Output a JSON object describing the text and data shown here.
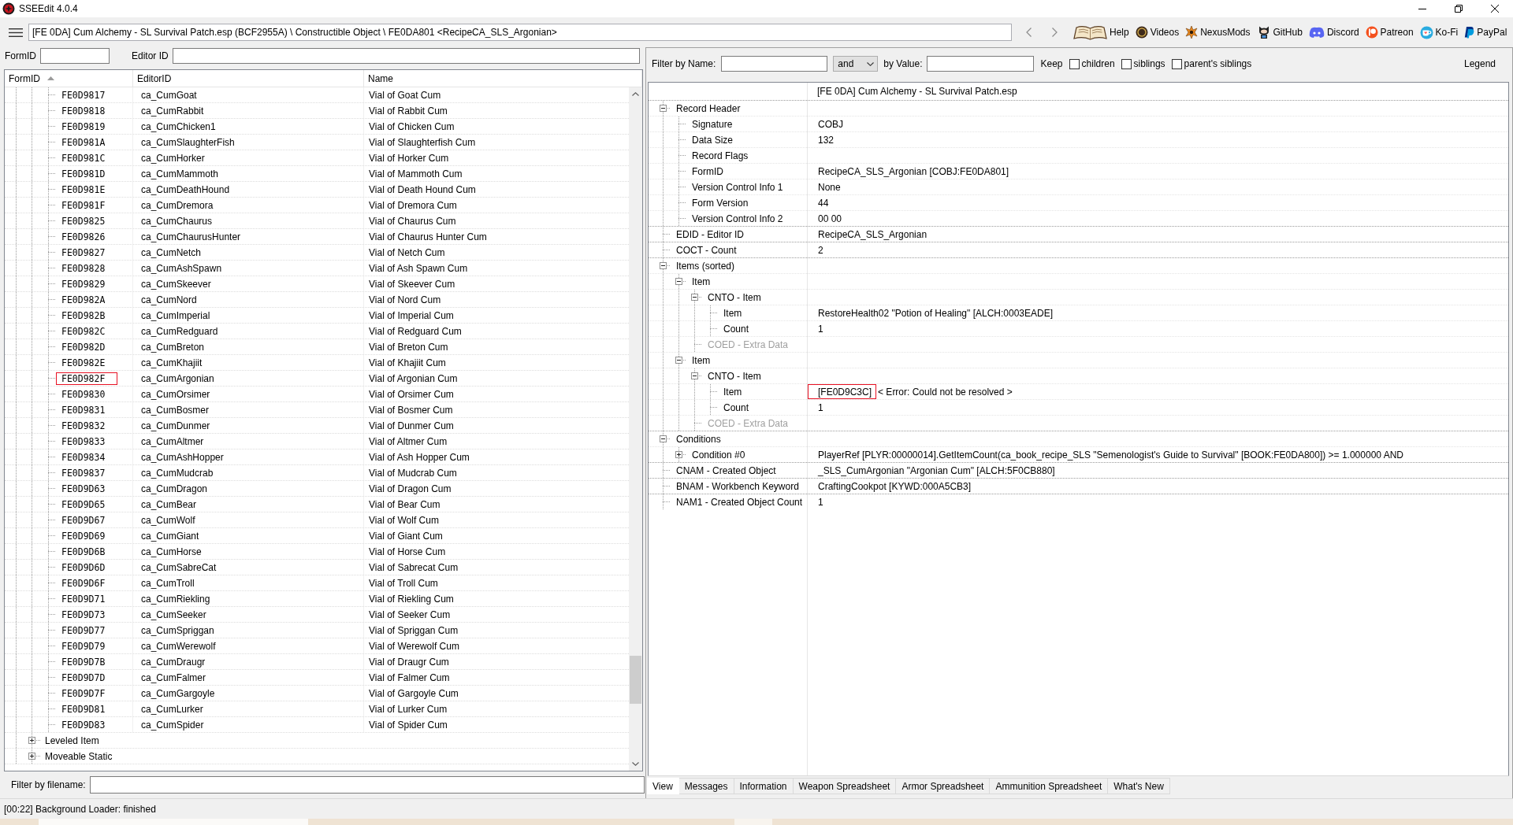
{
  "window": {
    "title": "SSEEdit 4.0.4"
  },
  "toolbar": {
    "path": "[FE 0DA] Cum Alchemy - SL Survival Patch.esp (BCF2955A) \\ Constructible Object \\ FE0DA801 <RecipeCA_SLS_Argonian>",
    "links": [
      {
        "kind": "book",
        "label": "Help"
      },
      {
        "kind": "gp",
        "label": "Videos"
      },
      {
        "kind": "nexus",
        "label": "NexusMods"
      },
      {
        "kind": "github",
        "label": "GitHub"
      },
      {
        "kind": "discord",
        "label": "Discord"
      },
      {
        "kind": "patreon",
        "label": "Patreon"
      },
      {
        "kind": "kofi",
        "label": "Ko-Fi"
      },
      {
        "kind": "paypal",
        "label": "PayPal"
      }
    ]
  },
  "left_pane": {
    "form_id_label": "FormID",
    "editor_id_label": "Editor ID",
    "list": {
      "columns": [
        {
          "label": "FormID",
          "sorted": true
        },
        {
          "label": "EditorID",
          "sorted": false
        },
        {
          "label": "Name",
          "sorted": false
        }
      ],
      "rows": [
        {
          "form_id": "FE0D9817",
          "editor_id": "ca_CumGoat",
          "name": "Vial of Goat Cum",
          "selected": false
        },
        {
          "form_id": "FE0D9818",
          "editor_id": "ca_CumRabbit",
          "name": "Vial of Rabbit Cum",
          "selected": false
        },
        {
          "form_id": "FE0D9819",
          "editor_id": "ca_CumChicken1",
          "name": "Vial of Chicken Cum",
          "selected": false
        },
        {
          "form_id": "FE0D981A",
          "editor_id": "ca_CumSlaughterFish",
          "name": "Vial of Slaughterfish Cum",
          "selected": false
        },
        {
          "form_id": "FE0D981C",
          "editor_id": "ca_CumHorker",
          "name": "Vial of Horker Cum",
          "selected": false
        },
        {
          "form_id": "FE0D981D",
          "editor_id": "ca_CumMammoth",
          "name": "Vial of Mammoth Cum",
          "selected": false
        },
        {
          "form_id": "FE0D981E",
          "editor_id": "ca_CumDeathHound",
          "name": "Vial of Death Hound Cum",
          "selected": false
        },
        {
          "form_id": "FE0D981F",
          "editor_id": "ca_CumDremora",
          "name": "Vial of Dremora Cum",
          "selected": false
        },
        {
          "form_id": "FE0D9825",
          "editor_id": "ca_CumChaurus",
          "name": "Vial of Chaurus Cum",
          "selected": false
        },
        {
          "form_id": "FE0D9826",
          "editor_id": "ca_CumChaurusHunter",
          "name": "Vial of Chaurus Hunter Cum",
          "selected": false
        },
        {
          "form_id": "FE0D9827",
          "editor_id": "ca_CumNetch",
          "name": "Vial of Netch Cum",
          "selected": false
        },
        {
          "form_id": "FE0D9828",
          "editor_id": "ca_CumAshSpawn",
          "name": "Vial of Ash Spawn Cum",
          "selected": false
        },
        {
          "form_id": "FE0D9829",
          "editor_id": "ca_CumSkeever",
          "name": "Vial of Skeever Cum",
          "selected": false
        },
        {
          "form_id": "FE0D982A",
          "editor_id": "ca_CumNord",
          "name": "Vial of Nord Cum",
          "selected": false
        },
        {
          "form_id": "FE0D982B",
          "editor_id": "ca_CumImperial",
          "name": "Vial of Imperial Cum",
          "selected": false
        },
        {
          "form_id": "FE0D982C",
          "editor_id": "ca_CumRedguard",
          "name": "Vial of Redguard Cum",
          "selected": false
        },
        {
          "form_id": "FE0D982D",
          "editor_id": "ca_CumBreton",
          "name": "Vial of Breton Cum",
          "selected": false
        },
        {
          "form_id": "FE0D982E",
          "editor_id": "ca_CumKhajiit",
          "name": "Vial of Khajiit Cum",
          "selected": false
        },
        {
          "form_id": "FE0D982F",
          "editor_id": "ca_CumArgonian",
          "name": "Vial of Argonian Cum",
          "selected": true
        },
        {
          "form_id": "FE0D9830",
          "editor_id": "ca_CumOrsimer",
          "name": "Vial of Orsimer Cum",
          "selected": false
        },
        {
          "form_id": "FE0D9831",
          "editor_id": "ca_CumBosmer",
          "name": "Vial of Bosmer Cum",
          "selected": false
        },
        {
          "form_id": "FE0D9832",
          "editor_id": "ca_CumDunmer",
          "name": "Vial of Dunmer Cum",
          "selected": false
        },
        {
          "form_id": "FE0D9833",
          "editor_id": "ca_CumAltmer",
          "name": "Vial of Altmer Cum",
          "selected": false
        },
        {
          "form_id": "FE0D9834",
          "editor_id": "ca_CumAshHopper",
          "name": "Vial of Ash Hopper Cum",
          "selected": false
        },
        {
          "form_id": "FE0D9837",
          "editor_id": "ca_CumMudcrab",
          "name": "Vial of Mudcrab Cum",
          "selected": false
        },
        {
          "form_id": "FE0D9D63",
          "editor_id": "ca_CumDragon",
          "name": "Vial of Dragon Cum",
          "selected": false
        },
        {
          "form_id": "FE0D9D65",
          "editor_id": "ca_CumBear",
          "name": "Vial of Bear Cum",
          "selected": false
        },
        {
          "form_id": "FE0D9D67",
          "editor_id": "ca_CumWolf",
          "name": "Vial of Wolf Cum",
          "selected": false
        },
        {
          "form_id": "FE0D9D69",
          "editor_id": "ca_CumGiant",
          "name": "Vial of Giant Cum",
          "selected": false
        },
        {
          "form_id": "FE0D9D6B",
          "editor_id": "ca_CumHorse",
          "name": "Vial of Horse Cum",
          "selected": false
        },
        {
          "form_id": "FE0D9D6D",
          "editor_id": "ca_CumSabreCat",
          "name": "Vial of Sabrecat Cum",
          "selected": false
        },
        {
          "form_id": "FE0D9D6F",
          "editor_id": "ca_CumTroll",
          "name": "Vial of Troll Cum",
          "selected": false
        },
        {
          "form_id": "FE0D9D71",
          "editor_id": "ca_CumRiekling",
          "name": "Vial of Riekling Cum",
          "selected": false
        },
        {
          "form_id": "FE0D9D73",
          "editor_id": "ca_CumSeeker",
          "name": "Vial of Seeker Cum",
          "selected": false
        },
        {
          "form_id": "FE0D9D77",
          "editor_id": "ca_CumSpriggan",
          "name": "Vial of Spriggan Cum",
          "selected": false
        },
        {
          "form_id": "FE0D9D79",
          "editor_id": "ca_CumWerewolf",
          "name": "Vial of Werewolf Cum",
          "selected": false
        },
        {
          "form_id": "FE0D9D7B",
          "editor_id": "ca_CumDraugr",
          "name": "Vial of Draugr Cum",
          "selected": false
        },
        {
          "form_id": "FE0D9D7D",
          "editor_id": "ca_CumFalmer",
          "name": "Vial of Falmer Cum",
          "selected": false
        },
        {
          "form_id": "FE0D9D7F",
          "editor_id": "ca_CumGargoyle",
          "name": "Vial of Gargoyle Cum",
          "selected": false
        },
        {
          "form_id": "FE0D9D81",
          "editor_id": "ca_CumLurker",
          "name": "Vial of Lurker Cum",
          "selected": false
        },
        {
          "form_id": "FE0D9D83",
          "editor_id": "ca_CumSpider",
          "name": "Vial of Spider Cum",
          "selected": false
        }
      ],
      "groups": [
        {
          "label": "Leveled Item",
          "expanded": false
        },
        {
          "label": "Moveable Static",
          "expanded": false
        }
      ]
    },
    "filename_label": "Filter by filename:"
  },
  "right_pane": {
    "filter": {
      "name_label": "Filter by Name:",
      "operator": "and",
      "value_label": "by Value:",
      "keep_label": "Keep",
      "options": [
        {
          "label": "children",
          "checked": false
        },
        {
          "label": "siblings",
          "checked": false
        },
        {
          "label": "parent's siblings",
          "checked": false
        }
      ],
      "legend": "Legend"
    },
    "record": {
      "file": "[FE 0DA] Cum Alchemy - SL Survival Patch.esp",
      "nodes": [
        {
          "label": "Record Header",
          "expanded": true,
          "disabled": false,
          "selected": false,
          "children": [
            {
              "label": "Signature",
              "value": "COBJ",
              "disabled": false,
              "selected": false
            },
            {
              "label": "Data Size",
              "value": "132",
              "disabled": false,
              "selected": false
            },
            {
              "label": "Record Flags",
              "disabled": false,
              "selected": false
            },
            {
              "label": "FormID",
              "value": "RecipeCA_SLS_Argonian [COBJ:FE0DA801]",
              "disabled": false,
              "selected": false
            },
            {
              "label": "Version Control Info 1",
              "value": "None",
              "disabled": false,
              "selected": false
            },
            {
              "label": "Form Version",
              "value": "44",
              "disabled": false,
              "selected": false
            },
            {
              "label": "Version Control Info 2",
              "value": "00 00",
              "disabled": false,
              "selected": false
            }
          ]
        },
        {
          "label": "EDID - Editor ID",
          "value": "RecipeCA_SLS_Argonian",
          "disabled": false,
          "selected": false
        },
        {
          "label": "COCT - Count",
          "value": "2",
          "disabled": false,
          "selected": false
        },
        {
          "label": "Items (sorted)",
          "expanded": true,
          "disabled": false,
          "selected": false,
          "children": [
            {
              "label": "Item",
              "expanded": true,
              "disabled": false,
              "selected": false,
              "children": [
                {
                  "label": "CNTO - Item",
                  "expanded": true,
                  "disabled": false,
                  "selected": false,
                  "children": [
                    {
                      "label": "Item",
                      "value": "RestoreHealth02 \"Potion of Healing\" [ALCH:0003EADE]",
                      "disabled": false,
                      "selected": false
                    },
                    {
                      "label": "Count",
                      "value": "1",
                      "disabled": false,
                      "selected": false
                    }
                  ]
                },
                {
                  "label": "COED - Extra Data",
                  "disabled": true,
                  "selected": false
                }
              ]
            },
            {
              "label": "Item",
              "expanded": true,
              "disabled": false,
              "selected": false,
              "children": [
                {
                  "label": "CNTO - Item",
                  "expanded": true,
                  "disabled": false,
                  "selected": false,
                  "children": [
                    {
                      "label": "Item",
                      "value": "[FE0D9C3C]",
                      "note": "< Error: Could not be resolved >",
                      "disabled": false,
                      "selected": true
                    },
                    {
                      "label": "Count",
                      "value": "1",
                      "disabled": false,
                      "selected": false
                    }
                  ]
                },
                {
                  "label": "COED - Extra Data",
                  "disabled": true,
                  "selected": false
                }
              ]
            }
          ]
        },
        {
          "label": "Conditions",
          "expanded": true,
          "disabled": false,
          "selected": false,
          "children": [
            {
              "label": "Condition #0",
              "expanded": false,
              "value": "PlayerRef [PLYR:00000014].GetItemCount(ca_book_recipe_SLS \"Semenologist's Guide to Survival\" [BOOK:FE0DA800]) >= 1.000000 AND",
              "disabled": false,
              "selected": false
            }
          ]
        },
        {
          "label": "CNAM - Created Object",
          "value": "_SLS_CumArgonian \"Argonian Cum\" [ALCH:5F0CB880]",
          "disabled": false,
          "selected": false
        },
        {
          "label": "BNAM - Workbench Keyword",
          "value": "CraftingCookpot [KYWD:000A5CB3]",
          "disabled": false,
          "selected": false
        },
        {
          "label": "NAM1 - Created Object Count",
          "value": "1",
          "disabled": false,
          "selected": false
        }
      ]
    },
    "tabs": [
      {
        "label": "View",
        "selected": true
      },
      {
        "label": "Messages",
        "selected": false
      },
      {
        "label": "Information",
        "selected": false
      },
      {
        "label": "Weapon Spreadsheet",
        "selected": false
      },
      {
        "label": "Armor Spreadsheet",
        "selected": false
      },
      {
        "label": "Ammunition Spreadsheet",
        "selected": false
      },
      {
        "label": "What's New",
        "selected": false
      }
    ]
  },
  "status_bar": {
    "message": "[00:22] Background Loader: finished"
  }
}
